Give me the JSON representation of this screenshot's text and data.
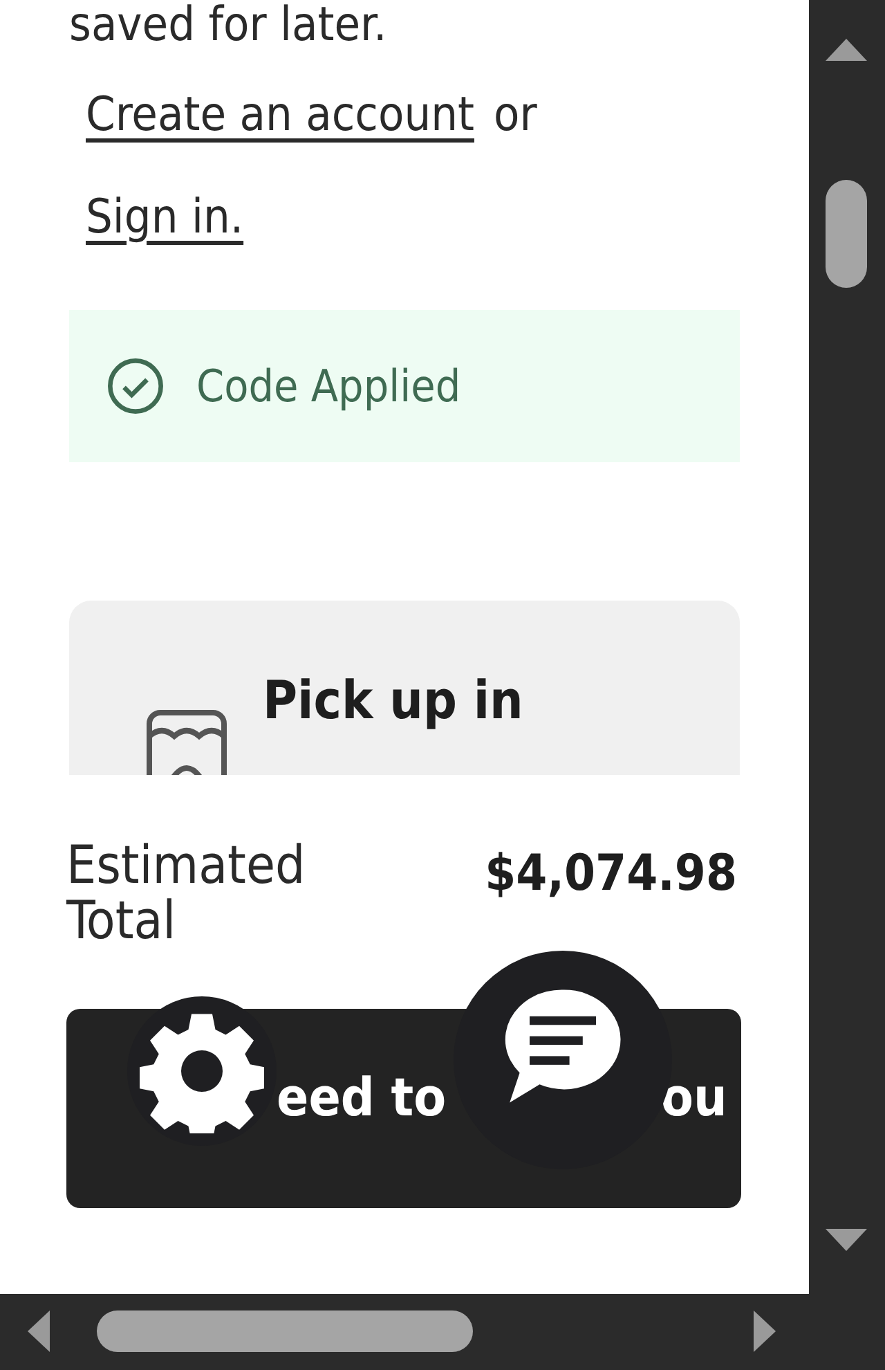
{
  "intro_text": "saved for later.",
  "account_prompt": {
    "create_link": "Create an account",
    "joiner": "or",
    "sign_in_link": "Sign in."
  },
  "promo_status": {
    "label": "Code Applied"
  },
  "pickup_option": {
    "label": "Pick up in"
  },
  "summary": {
    "total_label": "Estimated Total",
    "total_value": "$4,074.98"
  },
  "checkout_button": {
    "label_parts": [
      "eed to",
      "ou"
    ]
  }
}
